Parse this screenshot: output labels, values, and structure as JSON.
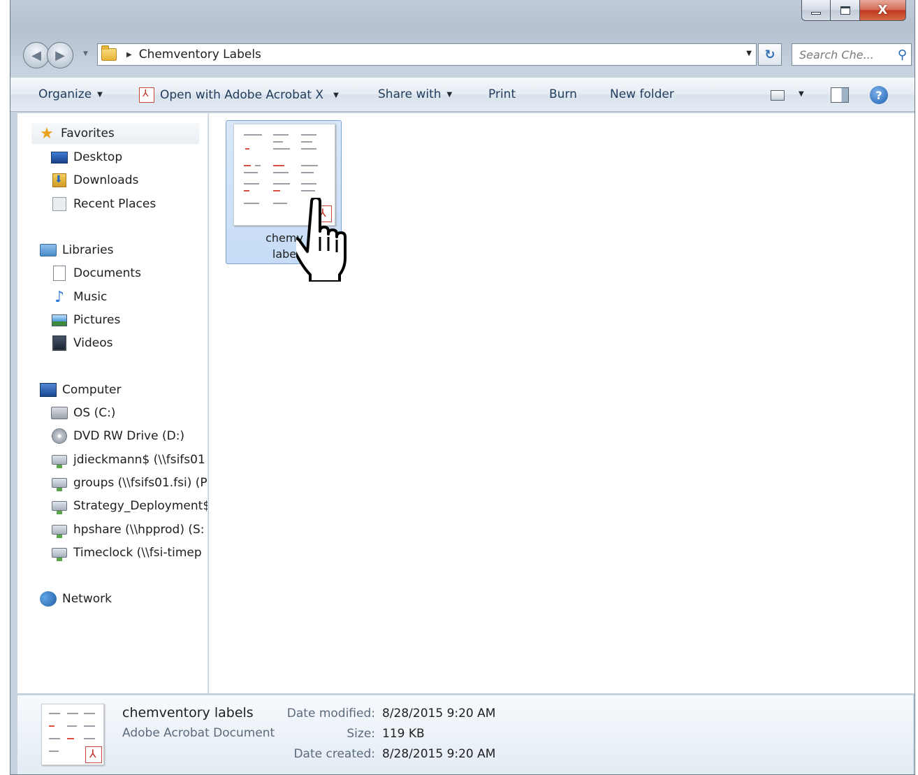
{
  "window": {
    "minimize_glyph": "",
    "close_glyph": "X"
  },
  "address": {
    "breadcrumb": "Chemventory Labels",
    "search_placeholder": "Search Che..."
  },
  "toolbar": {
    "organize": "Organize",
    "open_with": "Open with Adobe Acrobat X",
    "share_with": "Share with",
    "print": "Print",
    "burn": "Burn",
    "new_folder": "New folder"
  },
  "nav": {
    "favorites": "Favorites",
    "desktop": "Desktop",
    "downloads": "Downloads",
    "recent": "Recent Places",
    "libraries": "Libraries",
    "documents": "Documents",
    "music": "Music",
    "pictures": "Pictures",
    "videos": "Videos",
    "computer": "Computer",
    "drive_c": "OS (C:)",
    "drive_d": "DVD RW Drive (D:)",
    "share1": "jdieckmann$ (\\\\fsifs01",
    "share2": "groups (\\\\fsifs01.fsi) (P",
    "share3": "Strategy_Deployment$",
    "share4": "hpshare (\\\\hpprod) (S:",
    "share5": "Timeclock (\\\\fsi-timep",
    "network": "Network"
  },
  "file": {
    "label_line1": "chemv",
    "label_line2": "labe"
  },
  "details": {
    "name": "chemventory labels",
    "type": "Adobe Acrobat Document",
    "modified_label": "Date modified:",
    "modified_value": "8/28/2015 9:20 AM",
    "size_label": "Size:",
    "size_value": "119 KB",
    "created_label": "Date created:",
    "created_value": "8/28/2015 9:20 AM"
  },
  "colors": {
    "accent": "#1f3c5b",
    "selection": "#c6dcf6",
    "pdf_red": "#c42b1c"
  }
}
